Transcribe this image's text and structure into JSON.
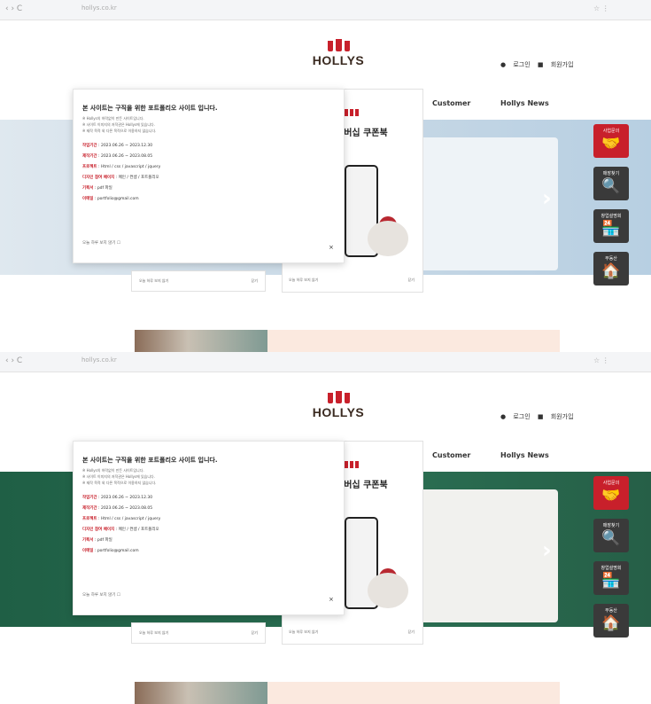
{
  "shots": [
    {
      "browser": {
        "nav": "‹  ›  C",
        "url": "hollys.co.kr",
        "right": "☆   ⋮"
      },
      "logo": {
        "brand": "HOLLYS"
      },
      "util": {
        "login": "로그인",
        "join": "회원가입"
      },
      "gnb": {
        "customer": "Customer",
        "news": "Hollys News"
      },
      "popup": {
        "title": "본 사이트는 구직을 위한 포트폴리오 사이트 입니다.",
        "lines": [
          "※ Hollys의 허락없이 만든 사이트입니다.",
          "※ 사이트 이미지의 저작권은 Hollys에 있습니다.",
          "※ 제작 목적 외 다른 목적으로 이용하지 않습니다."
        ],
        "rows": [
          {
            "k": "작업기간",
            "v": "2023.06.26 ~ 2023.12.30"
          },
          {
            "k": "제작기간",
            "v": "2023.06.26 ~ 2023.08.05"
          },
          {
            "k": "프로젝트",
            "v": "Html / css / javascript / jquery"
          },
          {
            "k": "디자인 참여 페이지",
            "v": "메인 / 컨셉 / 포트폴리오"
          },
          {
            "k": "기획서",
            "v": "pdf 파일"
          },
          {
            "k": "이메일",
            "v": "portfolio@gmail.com"
          }
        ],
        "dont_show": "오늘 하루 보지 않기 ☐",
        "close": "×"
      },
      "poster": {
        "title": "멤버십 쿠폰북"
      },
      "poster_footer": {
        "left": "오늘 하루 보지 않기",
        "right": "닫기"
      },
      "quick": [
        {
          "label": "사업문의",
          "icon": "🤝"
        },
        {
          "label": "매장찾기",
          "icon": "🔍"
        },
        {
          "label": "창업설명회",
          "icon": "🏪"
        },
        {
          "label": "부동산",
          "icon": "🏠"
        }
      ]
    },
    {
      "browser": {
        "nav": "‹  ›  C",
        "url": "hollys.co.kr",
        "right": "☆   ⋮"
      },
      "logo": {
        "brand": "HOLLYS"
      },
      "util": {
        "login": "로그인",
        "join": "회원가입"
      },
      "gnb": {
        "customer": "Customer",
        "news": "Hollys News"
      },
      "popup": {
        "title": "본 사이트는 구직을 위한 포트폴리오 사이트 입니다.",
        "lines": [
          "※ Hollys의 허락없이 만든 사이트입니다.",
          "※ 사이트 이미지의 저작권은 Hollys에 있습니다.",
          "※ 제작 목적 외 다른 목적으로 이용하지 않습니다."
        ],
        "rows": [
          {
            "k": "작업기간",
            "v": "2023.06.26 ~ 2023.12.30"
          },
          {
            "k": "제작기간",
            "v": "2023.06.26 ~ 2023.08.05"
          },
          {
            "k": "프로젝트",
            "v": "Html / css / javascript / jquery"
          },
          {
            "k": "디자인 참여 페이지",
            "v": "메인 / 컨셉 / 포트폴리오"
          },
          {
            "k": "기획서",
            "v": "pdf 파일"
          },
          {
            "k": "이메일",
            "v": "portfolio@gmail.com"
          }
        ],
        "dont_show": "오늘 하루 보지 않기 ☐",
        "close": "×"
      },
      "poster": {
        "title": "멤버십 쿠폰북"
      },
      "poster_footer": {
        "left": "오늘 하루 보지 않기",
        "right": "닫기"
      },
      "quick": [
        {
          "label": "사업문의",
          "icon": "🤝"
        },
        {
          "label": "매장찾기",
          "icon": "🔍"
        },
        {
          "label": "창업설명회",
          "icon": "🏪"
        },
        {
          "label": "부동산",
          "icon": "🏠"
        }
      ]
    }
  ]
}
